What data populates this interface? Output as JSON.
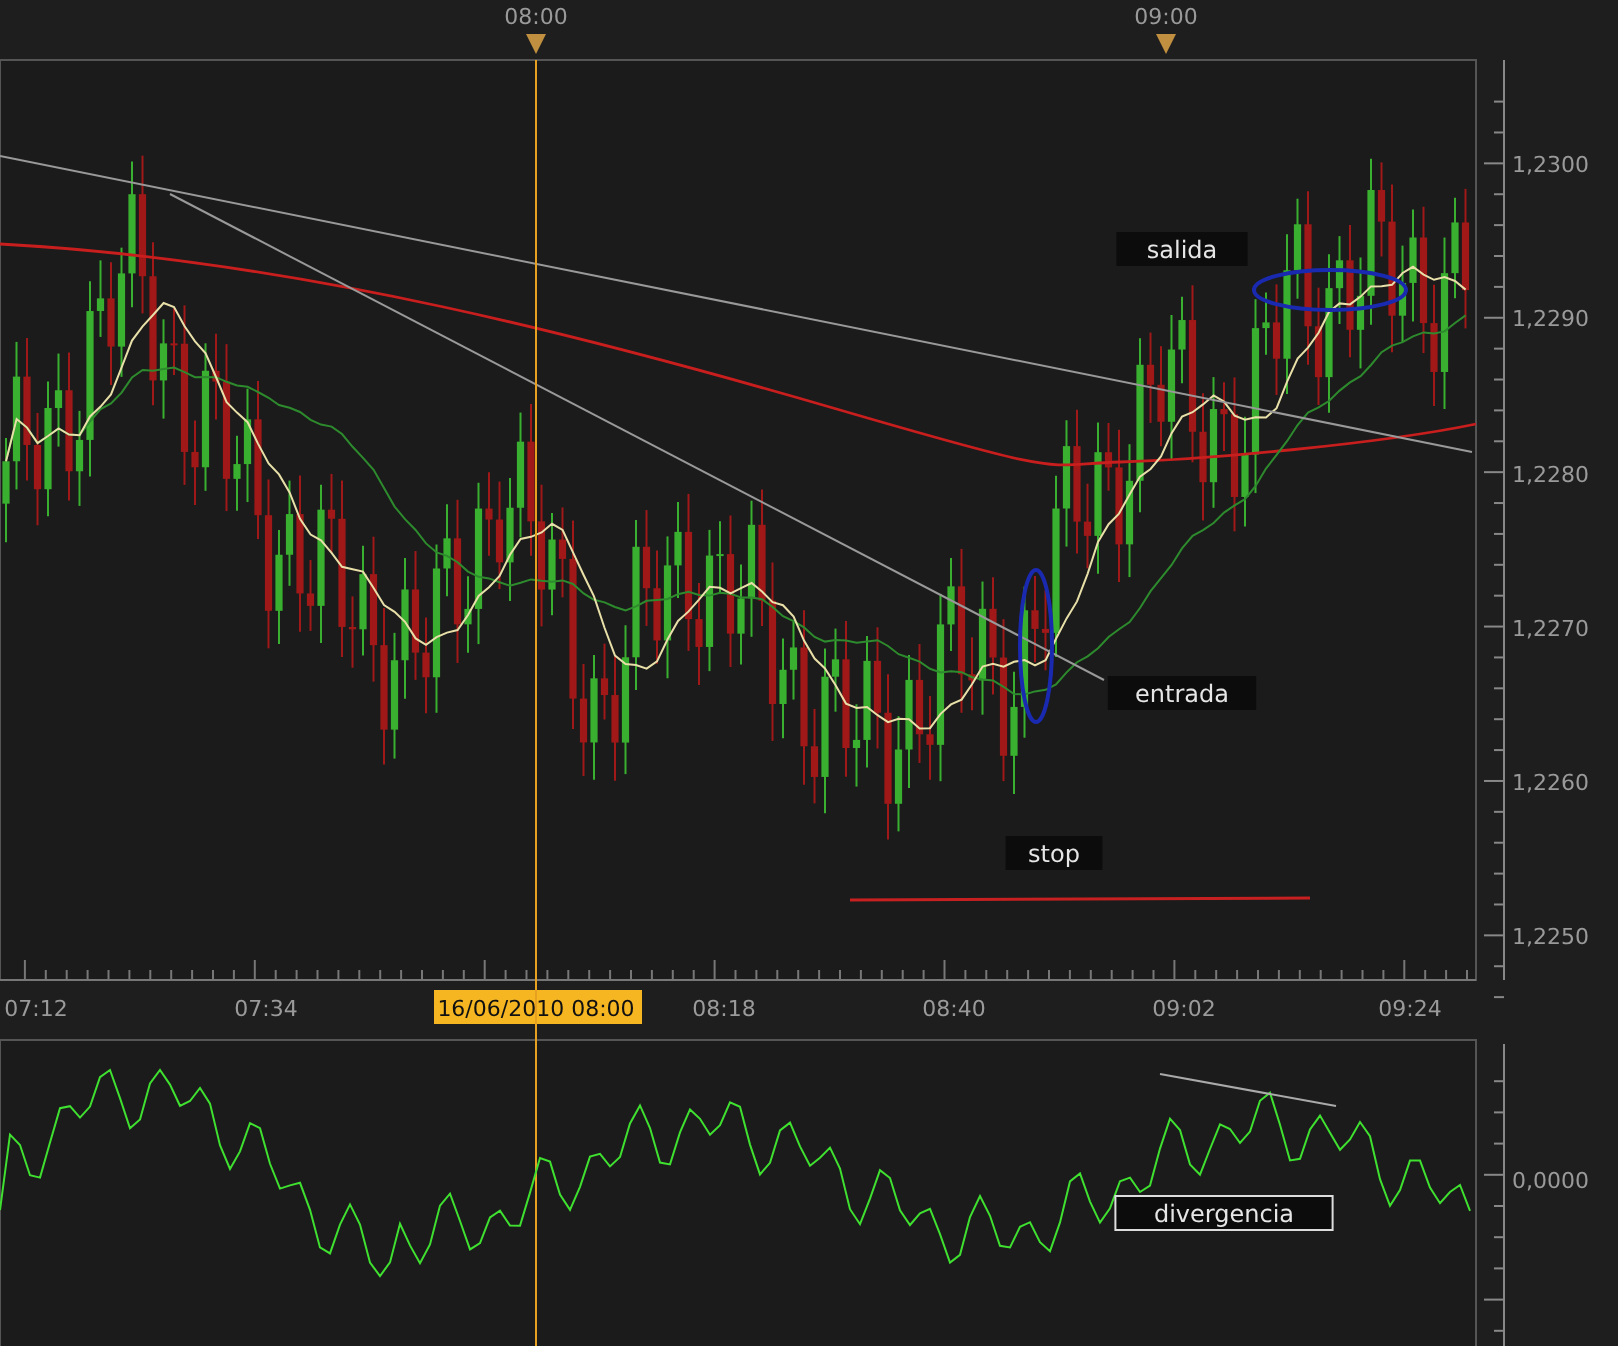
{
  "top_time_labels": [
    {
      "text": "08:00"
    },
    {
      "text": "09:00"
    }
  ],
  "price_axis": [
    "1,2300",
    "1,2290",
    "1,2280",
    "1,2270",
    "1,2260",
    "1,2250"
  ],
  "time_axis": [
    {
      "text": "07:12",
      "highlighted": false
    },
    {
      "text": "07:34",
      "highlighted": false
    },
    {
      "text": "16/06/2010 08:00",
      "highlighted": true
    },
    {
      "text": "08:18",
      "highlighted": false
    },
    {
      "text": "08:40",
      "highlighted": false
    },
    {
      "text": "09:02",
      "highlighted": false
    },
    {
      "text": "09:24",
      "highlighted": false
    }
  ],
  "annotations": [
    {
      "text": "salida",
      "kind": "tag"
    },
    {
      "text": "entrada",
      "kind": "tag"
    },
    {
      "text": "stop",
      "kind": "tag"
    },
    {
      "text": "divergencia",
      "kind": "outlined"
    }
  ],
  "oscillator_axis": [
    "0,0000"
  ]
}
